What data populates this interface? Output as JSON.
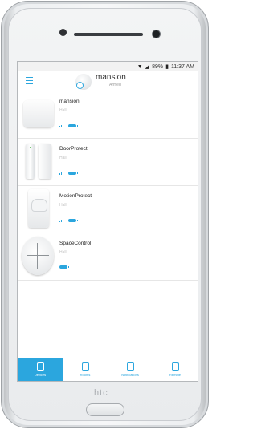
{
  "status_bar": {
    "signal_icon": "wifi-icon",
    "battery_text": "89%",
    "time": "11:37 AM"
  },
  "header": {
    "hub_name": "mansion",
    "hub_state": "Armed"
  },
  "devices": [
    {
      "name": "mansion",
      "room": "Hall",
      "image": "hub"
    },
    {
      "name": "DoorProtect",
      "room": "Hall",
      "image": "door"
    },
    {
      "name": "MotionProtect",
      "room": "Hall",
      "image": "motion"
    },
    {
      "name": "SpaceControl",
      "room": "Hall",
      "image": "remote"
    }
  ],
  "tabs": [
    {
      "label": "Devices",
      "icon": "devices-icon",
      "active": true
    },
    {
      "label": "Rooms",
      "icon": "rooms-icon",
      "active": false
    },
    {
      "label": "Notifications",
      "icon": "notifications-icon",
      "active": false
    },
    {
      "label": "Remote",
      "icon": "remote-icon",
      "active": false
    }
  ],
  "phone": {
    "brand": "htc"
  },
  "colors": {
    "accent": "#2ba6de"
  }
}
